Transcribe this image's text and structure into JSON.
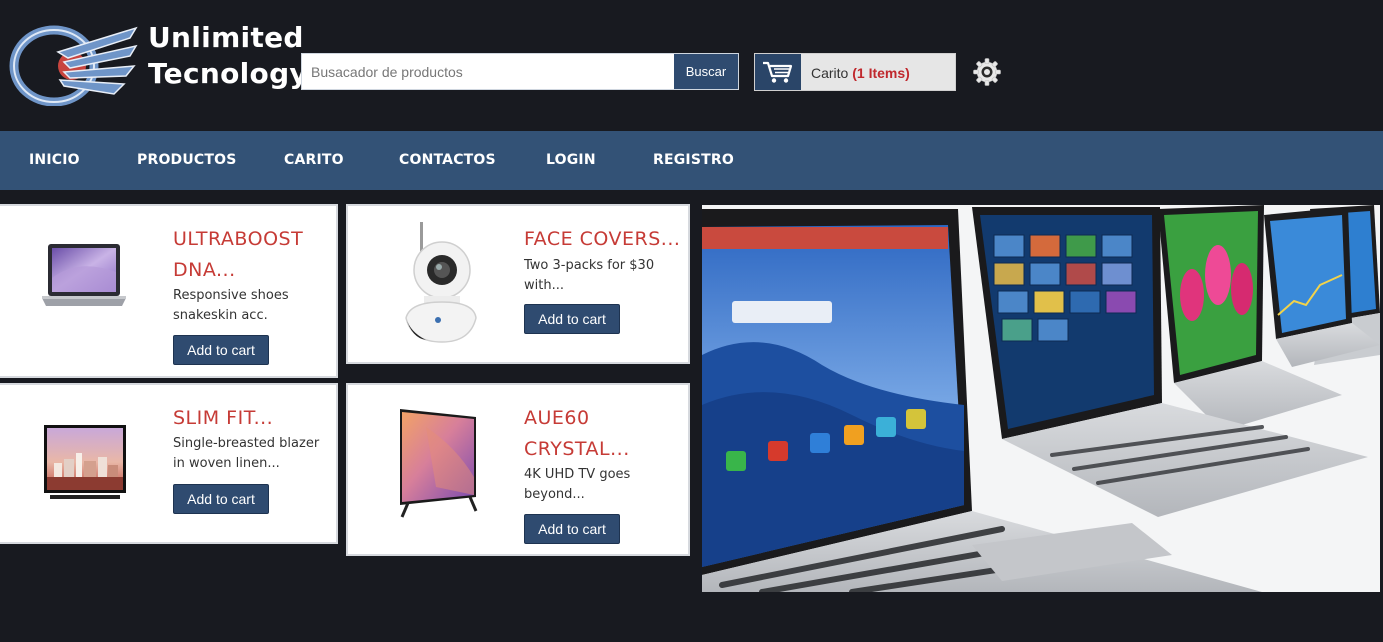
{
  "brand": {
    "line1": "Unlimited",
    "line2": "Tecnology"
  },
  "search": {
    "placeholder": "Busacador de productos",
    "button_label": "Buscar"
  },
  "cart": {
    "label": "Carito",
    "count_text": "(1 Items)"
  },
  "nav": {
    "items": [
      "INICIO",
      "PRODUCTOS",
      "CARITO",
      "CONTACTOS",
      "LOGIN",
      "REGISTRO"
    ]
  },
  "products": [
    {
      "title_line1": "ULTRABOOST",
      "title_line2": "DNA...",
      "desc_line1": "Responsive shoes",
      "desc_line2": "snakeskin acc.",
      "button": "Add to cart"
    },
    {
      "title_line1": "FACE COVERS...",
      "title_line2": "",
      "desc_line1": "Two 3-packs for $30",
      "desc_line2": "with...",
      "button": "Add to cart"
    },
    {
      "title_line1": "SLIM FIT...",
      "title_line2": "",
      "desc_line1": "Single-breasted blazer",
      "desc_line2": "in woven linen...",
      "button": "Add to cart"
    },
    {
      "title_line1": "AUE60",
      "title_line2": "CRYSTAL...",
      "desc_line1": "4K UHD TV goes",
      "desc_line2": "beyond...",
      "button": "Add to cart"
    }
  ],
  "icons": {
    "cart": "shopping-cart-icon",
    "settings": "gear-icon"
  },
  "colors": {
    "header_bg": "#181a20",
    "nav_bg": "#335276",
    "accent_button": "#2f4b70",
    "product_title": "#c63b36",
    "cart_count": "#c0282d"
  }
}
